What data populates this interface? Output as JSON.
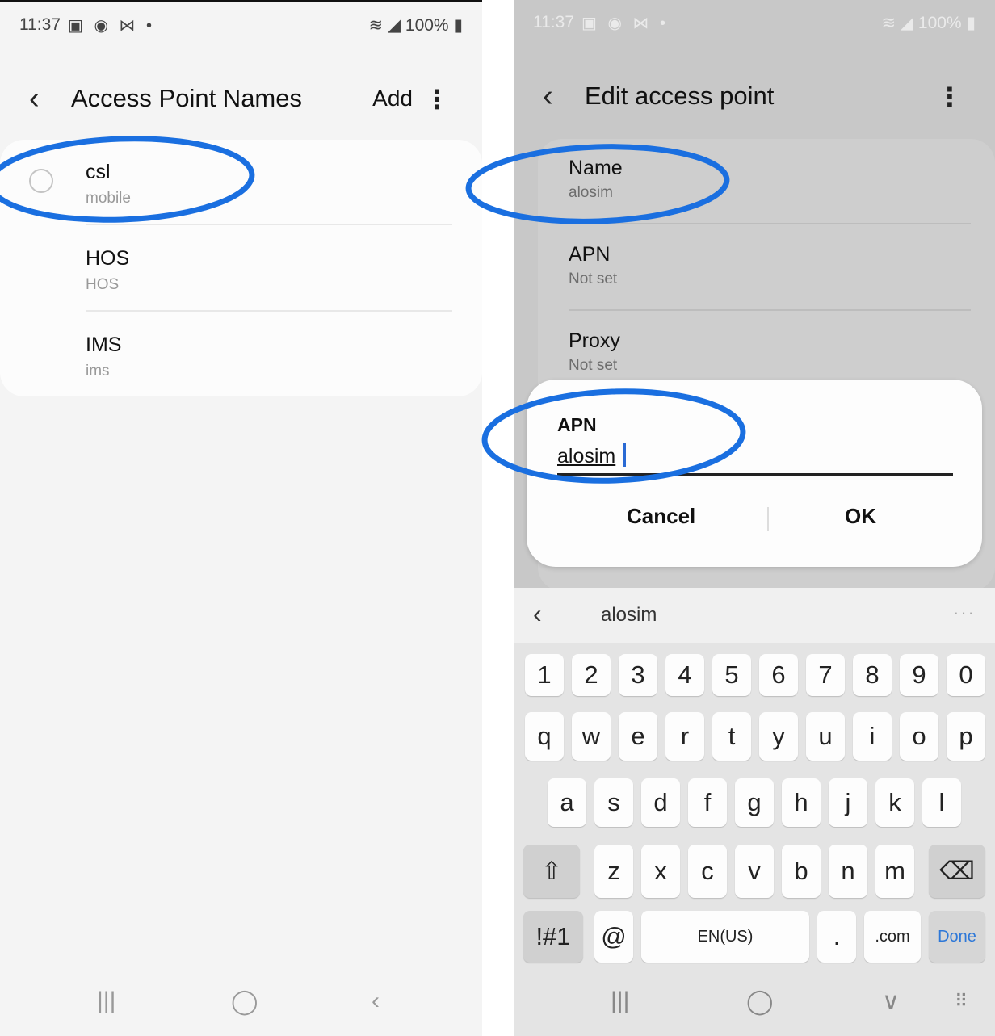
{
  "left": {
    "status": {
      "time": "11:37",
      "icons": "▣ ◉ ⋈ •",
      "battery": "100%"
    },
    "header": {
      "back": "‹",
      "title": "Access Point Names",
      "add": "Add",
      "more": "⋮"
    },
    "apns": [
      {
        "name": "csl",
        "type": "mobile"
      },
      {
        "name": "HOS",
        "type": "HOS"
      },
      {
        "name": "IMS",
        "type": "ims"
      }
    ],
    "nav": {
      "recents": "|||",
      "home": "◯",
      "back": "‹"
    }
  },
  "right": {
    "status": {
      "time": "11:37",
      "icons": "▣ ◉ ⋈ •",
      "battery": "100%"
    },
    "header": {
      "back": "‹",
      "title": "Edit access point",
      "more": "⋮"
    },
    "settings": [
      {
        "label": "Name",
        "value": "alosim"
      },
      {
        "label": "APN",
        "value": "Not set"
      },
      {
        "label": "Proxy",
        "value": "Not set"
      }
    ],
    "dialog": {
      "title": "APN",
      "value": "alosim",
      "cancel": "Cancel",
      "ok": "OK"
    },
    "keyboard": {
      "prediction_back": "‹",
      "prediction_word": "alosim",
      "prediction_more": "···",
      "row1": [
        "1",
        "2",
        "3",
        "4",
        "5",
        "6",
        "7",
        "8",
        "9",
        "0"
      ],
      "row2": [
        "q",
        "w",
        "e",
        "r",
        "t",
        "y",
        "u",
        "i",
        "o",
        "p"
      ],
      "row3": [
        "a",
        "s",
        "d",
        "f",
        "g",
        "h",
        "j",
        "k",
        "l"
      ],
      "row4": [
        "z",
        "x",
        "c",
        "v",
        "b",
        "n",
        "m"
      ],
      "shift": "⇧",
      "backspace": "⌫",
      "symbols": "!#1",
      "at": "@",
      "space": "EN(US)",
      "period": ".",
      "dotcom": ".com",
      "done": "Done"
    },
    "nav": {
      "recents": "|||",
      "home": "◯",
      "hide": "∨",
      "keyboard": "⠿"
    }
  },
  "colors": {
    "highlight": "#1a6fe0",
    "accent": "#2e78d8"
  }
}
